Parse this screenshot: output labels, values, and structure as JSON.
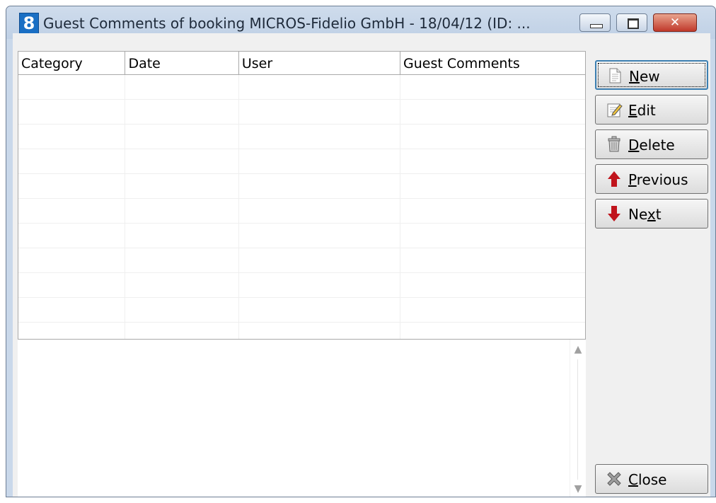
{
  "window": {
    "title": "Guest Comments of booking MICROS-Fidelio GmbH - 18/04/12 (ID: ...",
    "icon_text": "8",
    "controls": [
      "minimize-icon",
      "maximize-icon",
      "close-icon"
    ]
  },
  "grid": {
    "columns": [
      "Category",
      "Date",
      "User",
      "Guest Comments"
    ],
    "rows": []
  },
  "memo": {
    "text": ""
  },
  "buttons": {
    "new": {
      "label_underlined": "N",
      "label_rest": "ew",
      "icon": "document-icon"
    },
    "edit": {
      "label_underlined": "E",
      "label_rest": "dit",
      "icon": "edit-icon"
    },
    "delete": {
      "label_underlined": "D",
      "label_rest": "elete",
      "icon": "trash-icon"
    },
    "previous": {
      "label_underlined": "P",
      "label_rest": "revious",
      "icon": "arrow-up-icon"
    },
    "next": {
      "label_pre": "Ne",
      "label_underlined": "x",
      "label_rest": "t",
      "icon": "arrow-down-icon"
    },
    "close": {
      "label_underlined": "C",
      "label_rest": "lose",
      "icon": "close-x-icon"
    }
  },
  "colors": {
    "accent": "#1a6fc4",
    "arrow_red": "#c0141c",
    "close_button_red": "#c0392b"
  }
}
